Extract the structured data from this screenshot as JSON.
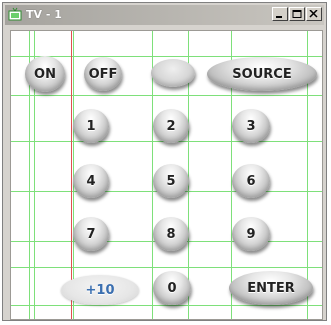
{
  "window": {
    "title": "TV - 1"
  },
  "power": {
    "on": "ON",
    "off": "OFF"
  },
  "source": "SOURCE",
  "digits": [
    "1",
    "2",
    "3",
    "4",
    "5",
    "6",
    "7",
    "8",
    "9",
    "0"
  ],
  "bottom": {
    "plus10": "+10",
    "enter": "ENTER"
  },
  "colors": {
    "grid": "#7ee07a",
    "guide": "#e05050",
    "plus10_text": "#3b6fb0"
  }
}
